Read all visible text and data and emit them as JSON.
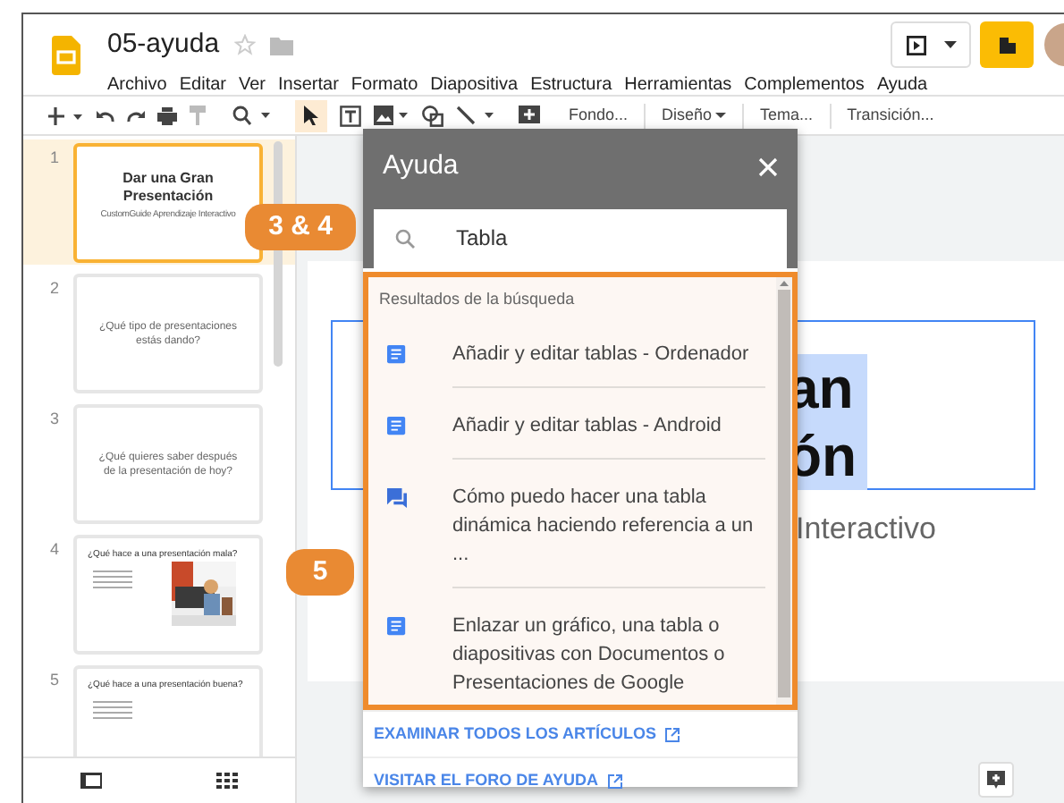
{
  "document": {
    "title": "05-ayuda"
  },
  "menu": [
    "Archivo",
    "Editar",
    "Ver",
    "Insertar",
    "Formato",
    "Diapositiva",
    "Estructura",
    "Herramientas",
    "Complementos",
    "Ayuda"
  ],
  "toolbar": {
    "text_buttons": [
      {
        "label": "Fondo...",
        "dropdown": false
      },
      {
        "label": "Diseño",
        "dropdown": true
      },
      {
        "label": "Tema...",
        "dropdown": false
      },
      {
        "label": "Transición...",
        "dropdown": false
      }
    ]
  },
  "slides": [
    {
      "number": "1",
      "selected": true,
      "kind": "title",
      "title": "Dar una Gran Presentación",
      "subtitle": "CustomGuide Aprendizaje Interactivo"
    },
    {
      "number": "2",
      "selected": false,
      "kind": "question",
      "title": "¿Qué tipo de presentaciones estás dando?"
    },
    {
      "number": "3",
      "selected": false,
      "kind": "question",
      "title": "¿Qué quieres saber después de la presentación de hoy?"
    },
    {
      "number": "4",
      "selected": false,
      "kind": "bullets_picture",
      "title": "¿Qué hace a una presentación mala?"
    },
    {
      "number": "5",
      "selected": false,
      "kind": "bullets",
      "title": "¿Qué hace a una presentación buena?"
    }
  ],
  "canvas": {
    "title_lines": [
      "an",
      "ón"
    ],
    "subtitle": "Interactivo"
  },
  "help_panel": {
    "title": "Ayuda",
    "search": {
      "value": "Tabla"
    },
    "results_heading": "Resultados de la búsqueda",
    "results": [
      {
        "kind": "article",
        "text": "Añadir y editar tablas - Ordenador"
      },
      {
        "kind": "article",
        "text": "Añadir y editar tablas - Android"
      },
      {
        "kind": "forum",
        "text": "Cómo puedo hacer una tabla dinámica haciendo referencia a un ..."
      },
      {
        "kind": "article",
        "text": "Enlazar un gráfico, una tabla o diapositivas con Documentos o Presentaciones de Google"
      }
    ],
    "links": [
      "EXAMINAR TODOS LOS ARTÍCULOS",
      "VISITAR EL FORO DE AYUDA"
    ]
  },
  "callouts": [
    {
      "label": "3 & 4"
    },
    {
      "label": "5"
    }
  ]
}
